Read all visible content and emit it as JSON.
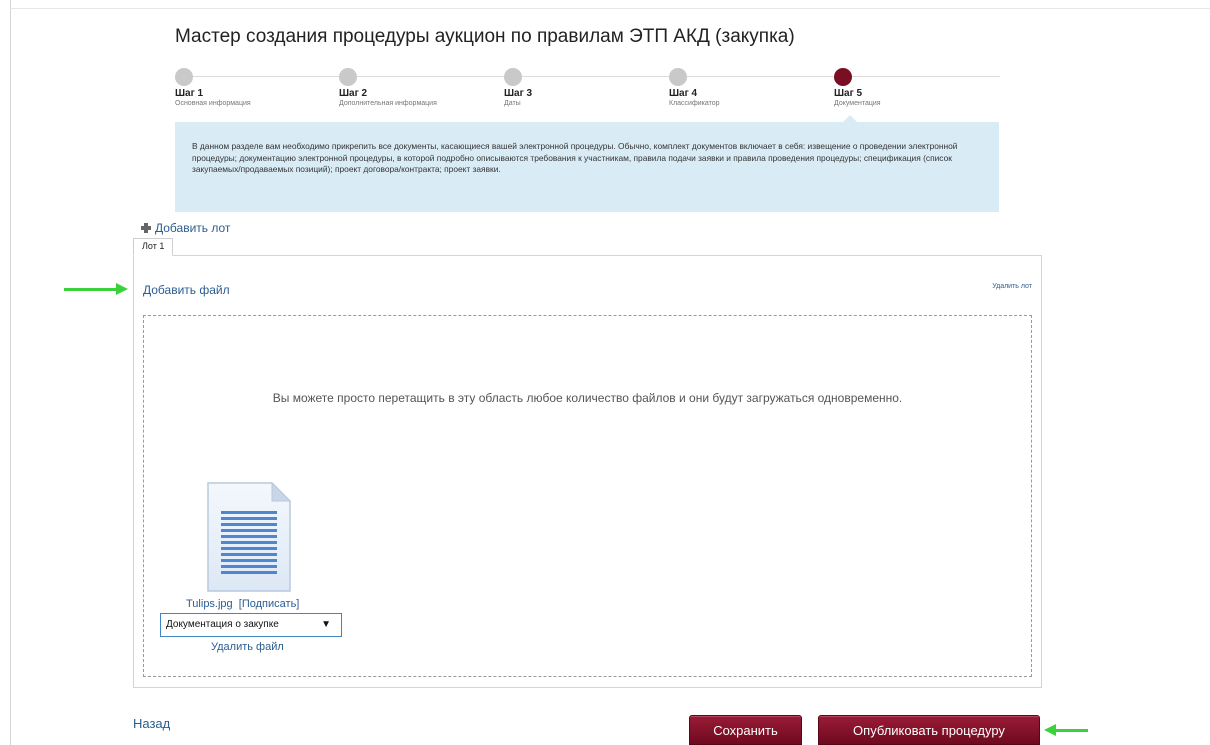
{
  "page": {
    "title": "Мастер создания процедуры аукцион по правилам ЭТП АКД (закупка)"
  },
  "steps": [
    {
      "label": "Шаг 1",
      "sub": "Основная информация",
      "state": "done"
    },
    {
      "label": "Шаг 2",
      "sub": "Дополнительная информация",
      "state": "done"
    },
    {
      "label": "Шаг 3",
      "sub": "Даты",
      "state": "done"
    },
    {
      "label": "Шаг 4",
      "sub": "Классификатор",
      "state": "done"
    },
    {
      "label": "Шаг 5",
      "sub": "Документация",
      "state": "active"
    }
  ],
  "info": {
    "text": "В данном разделе вам необходимо прикрепить все документы, касающиеся вашей электронной процедуры. Обычно, комплект документов включает в себя: извещение о проведении электронной процедуры; документацию электронной процедуры, в которой подробно описываются требования к участникам, правила подачи заявки и правила проведения процедуры; спецификация (список закупаемых/продаваемых позиций); проект договора/контракта; проект заявки."
  },
  "lots": {
    "add_label": "Добавить лот",
    "tab_label": "Лот 1",
    "add_file_label": "Добавить файл",
    "delete_lot_label": "Удалить лот",
    "drop_hint": "Вы можете просто перетащить в эту область любое количество файлов и они будут загружаться одновременно."
  },
  "file": {
    "name": "Tulips.jpg",
    "sign_label": "[Подписать]",
    "doc_type": "Документация о закупке",
    "delete_label": "Удалить файл",
    "icon": "document-icon"
  },
  "footer": {
    "back_label": "Назад",
    "save_label": "Сохранить",
    "publish_label": "Опубликовать процедуру"
  },
  "colors": {
    "accent": "#7a0e23",
    "link": "#2a5d8f",
    "info_bg": "#d9ecf6",
    "annotation_arrow": "#3ad13a"
  }
}
